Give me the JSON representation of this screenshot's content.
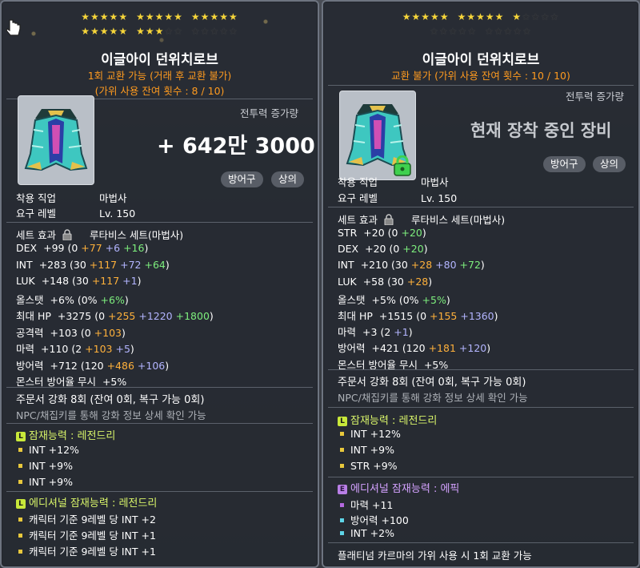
{
  "left": {
    "stars_on_row1": 15,
    "stars_on_row2": 8,
    "stars_total_row2": 15,
    "item_name": "이글아이 던위치로브",
    "trade_line": "1회 교환 가능 (거래 후 교환 불가)",
    "scissor_line": "(가위 사용 잔여 횟수 : 8 / 10)",
    "combat_power_label": "전투력 증가량",
    "combat_power_value": "+ 642만 3000",
    "tags": [
      "방어구",
      "상의"
    ],
    "req_job_label": "착용 직업",
    "req_job_value": "마법사",
    "req_level_label": "요구 레벨",
    "req_level_value": "Lv. 150",
    "set_label": "세트 효과",
    "set_value": "루타비스 세트(마법사)",
    "stats": [
      {
        "name": "DEX",
        "total": "+99",
        "base": "(0 ",
        "p1": "+77",
        "p2": " +6",
        "p3": " +16",
        "end": ")"
      },
      {
        "name": "INT",
        "total": "+283",
        "base": "(30 ",
        "p1": "+117",
        "p2": " +72",
        "p3": " +64",
        "end": ")"
      },
      {
        "name": "LUK",
        "total": "+148",
        "base": "(30 ",
        "p1": "+117",
        "p2": " +1",
        "p3": "",
        "end": ")"
      },
      {
        "name": "올스탯",
        "total": "+6%",
        "base": "(0% ",
        "p1": "",
        "p2": "",
        "p3": "+6%",
        "end": ")"
      },
      {
        "name": "최대 HP",
        "total": "+3275",
        "base": "(0 ",
        "p1": "+255",
        "p2": " +1220",
        "p3": " +1800",
        "end": ")"
      },
      {
        "name": "공격력",
        "total": "+103",
        "base": "(0 ",
        "p1": "+103",
        "p2": "",
        "p3": "",
        "end": ")"
      },
      {
        "name": "마력",
        "total": "+110",
        "base": "(2 ",
        "p1": "+103",
        "p2": " +5",
        "p3": "",
        "end": ")"
      },
      {
        "name": "방어력",
        "total": "+712",
        "base": "(120 ",
        "p1": "+486",
        "p2": " +106",
        "p3": "",
        "end": ")"
      },
      {
        "name": "몬스터 방어율 무시",
        "total": "+5%",
        "base": "",
        "p1": "",
        "p2": "",
        "p3": "",
        "end": ""
      }
    ],
    "upgrade_line": "주문서 강화 8회 (잔여 0회, 복구 가능 0회)",
    "npc_line": "NPC/채집키를 통해 강화 정보 상세 확인 가능",
    "potential_header": "잠재능력 : 레전드리",
    "potential_lines": [
      "INT +12%",
      "INT +9%",
      "INT +9%"
    ],
    "additional_header": "에디셔널 잠재능력 : 레전드리",
    "additional_lines": [
      "캐릭터 기준 9레벨 당 INT +2",
      "캐릭터 기준 9레벨 당 INT +1",
      "캐릭터 기준 9레벨 당 INT +1"
    ]
  },
  "right": {
    "stars_on_row1": 11,
    "stars_total_row1": 15,
    "stars_total_row2": 10,
    "item_name": "이글아이 던위치로브",
    "trade_line": "교환 불가 (가위 사용 잔여 횟수 : 10 / 10)",
    "combat_power_label": "전투력 증가량",
    "equipped_text": "현재 장착 중인 장비",
    "tags": [
      "방어구",
      "상의"
    ],
    "req_job_label": "착용 직업",
    "req_job_value": "마법사",
    "req_level_label": "요구 레벨",
    "req_level_value": "Lv. 150",
    "set_label": "세트 효과",
    "set_value": "루타비스 세트(마법사)",
    "stats": [
      {
        "name": "STR",
        "total": "+20",
        "base": "(0 ",
        "p1": "",
        "p2": "",
        "p3": "+20",
        "end": ")"
      },
      {
        "name": "DEX",
        "total": "+20",
        "base": "(0 ",
        "p1": "",
        "p2": "",
        "p3": "+20",
        "end": ")"
      },
      {
        "name": "INT",
        "total": "+210",
        "base": "(30 ",
        "p1": "+28",
        "p2": " +80",
        "p3": " +72",
        "end": ")"
      },
      {
        "name": "LUK",
        "total": "+58",
        "base": "(30 ",
        "p1": "+28",
        "p2": "",
        "p3": "",
        "end": ")"
      },
      {
        "name": "올스탯",
        "total": "+5%",
        "base": "(0% ",
        "p1": "",
        "p2": "",
        "p3": "+5%",
        "end": ")"
      },
      {
        "name": "최대 HP",
        "total": "+1515",
        "base": "(0 ",
        "p1": "+155",
        "p2": " +1360",
        "p3": "",
        "end": ")"
      },
      {
        "name": "마력",
        "total": "+3",
        "base": "(2 ",
        "p1": "",
        "p2": "+1",
        "p3": "",
        "end": ")"
      },
      {
        "name": "방어력",
        "total": "+421",
        "base": "(120 ",
        "p1": "+181",
        "p2": " +120",
        "p3": "",
        "end": ")"
      },
      {
        "name": "몬스터 방어율 무시",
        "total": "+5%",
        "base": "",
        "p1": "",
        "p2": "",
        "p3": "",
        "end": ""
      }
    ],
    "upgrade_line": "주문서 강화 8회 (잔여 0회, 복구 가능 0회)",
    "npc_line": "NPC/채집키를 통해 강화 정보 상세 확인 가능",
    "potential_header": "잠재능력 : 레전드리",
    "potential_lines": [
      "INT +12%",
      "INT +9%",
      "STR +9%"
    ],
    "additional_header": "에디셔널 잠재능력 : 에픽",
    "additional_lines": [
      "마력 +11",
      "방어력 +100",
      "INT +2%"
    ],
    "footer_line": "플래티넘 카르마의 가위 사용 시 1회 교환 가능"
  }
}
